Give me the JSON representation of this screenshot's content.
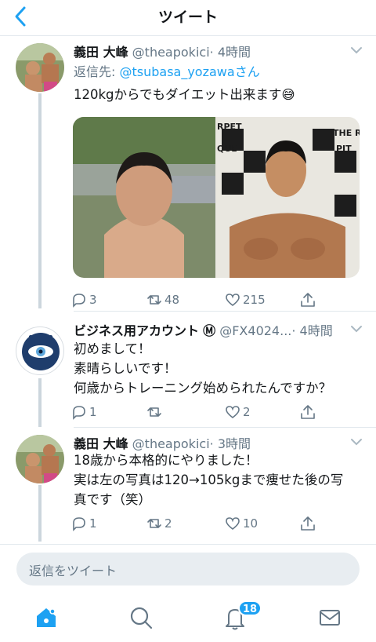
{
  "header": {
    "title": "ツイート"
  },
  "tweets": [
    {
      "name": "義田 大峰",
      "handle": "@theapokici",
      "time": "· 4時間",
      "reply_label": "返信先: ",
      "reply_mention": "@tsubasa_yozawa",
      "reply_suffix": "さん",
      "text": "120kgからでもダイエット出来ます😅",
      "media_text_top": "RPET",
      "media_text_mid": "QUE",
      "media_text_right1": "THE R",
      "media_text_right2": "PIT",
      "replies": "3",
      "retweets": "48",
      "likes": "215"
    },
    {
      "name": "ビジネス用アカウント",
      "verified_mark": "Ⓜ",
      "handle": "@FX4024...",
      "time": "· 4時間",
      "text_lines": [
        "初めまして！",
        "素晴らしいです！",
        "何歳からトレーニング始められたんですか？"
      ],
      "replies": "1",
      "retweets": "",
      "likes": "2"
    },
    {
      "name": "義田 大峰",
      "handle": "@theapokici",
      "time": "· 3時間",
      "text_lines": [
        "18歳から本格的にやりました！",
        "実は左の写真は120→105kgまで痩せた後の写",
        "真です（笑）"
      ],
      "replies": "1",
      "retweets": "2",
      "likes": "10"
    }
  ],
  "compose": {
    "placeholder": "返信をツイート"
  },
  "tabbar": {
    "notifications_badge": "18"
  },
  "colors": {
    "accent": "#1da1f2",
    "secondary_text": "#657786",
    "divider": "#e1e8ed"
  }
}
